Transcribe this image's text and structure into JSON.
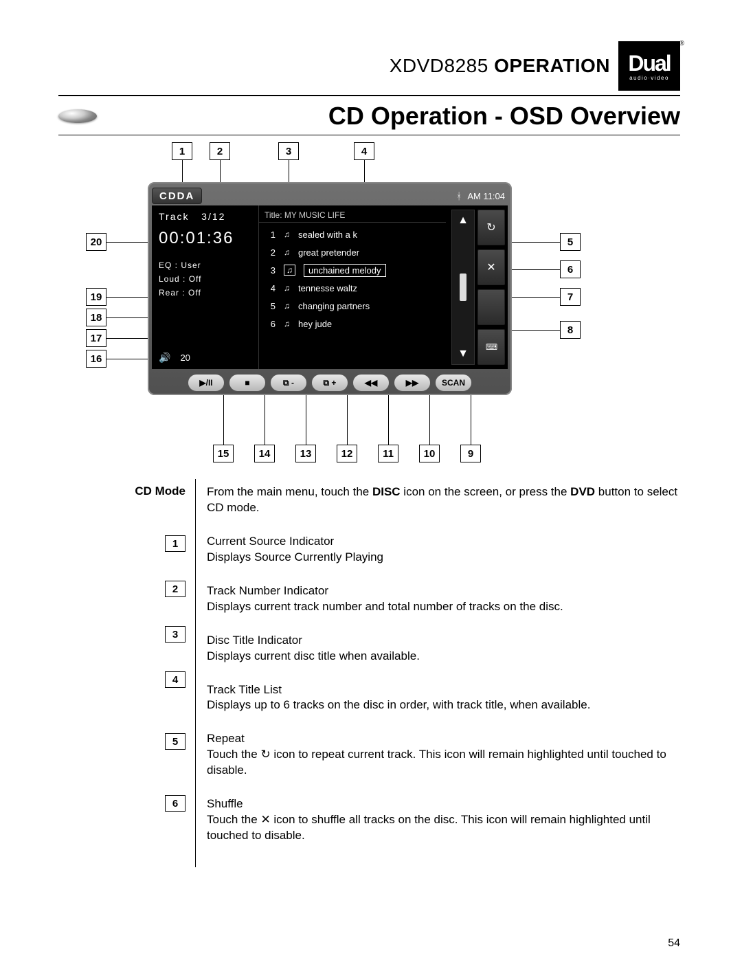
{
  "header": {
    "model": "XDVD8285",
    "word": "OPERATION",
    "logo_big": "Dual",
    "logo_sub": "audio·video"
  },
  "section_title": "CD Operation - OSD Overview",
  "callouts_top": [
    "1",
    "2",
    "3",
    "4"
  ],
  "callouts_right": [
    "5",
    "6",
    "7",
    "8"
  ],
  "callouts_left": [
    "20",
    "19",
    "18",
    "17",
    "16"
  ],
  "callouts_bottom": [
    "15",
    "14",
    "13",
    "12",
    "11",
    "10",
    "9"
  ],
  "device": {
    "source_badge": "CDDA",
    "clock": "AM 11:04",
    "track_label": "Track",
    "track_pos": "3/12",
    "timecode": "00:01:36",
    "eq": "EQ   : User",
    "loud": "Loud : Off",
    "rear": "Rear : Off",
    "volume": "20",
    "title_label": "Title: MY  MUSIC LIFE",
    "tracks": [
      {
        "n": "1",
        "name": "sealed with a k"
      },
      {
        "n": "2",
        "name": "great pretender"
      },
      {
        "n": "3",
        "name": "unchained melody",
        "selected": true
      },
      {
        "n": "4",
        "name": "tennesse waltz"
      },
      {
        "n": "5",
        "name": "changing partners"
      },
      {
        "n": "6",
        "name": "hey jude"
      }
    ],
    "side_buttons": {
      "repeat": "↻",
      "shuffle": "✕",
      "blank": "",
      "keyboard": "⌨"
    },
    "transport": {
      "playpause": "▶/II",
      "stop": "■",
      "folder_minus": "⧉ -",
      "folder_plus": "⧉ +",
      "rew": "◀◀",
      "ff": "▶▶",
      "scan": "SCAN"
    }
  },
  "desc": {
    "mode_label": "CD Mode",
    "mode_text_a": "From the main menu, touch the ",
    "mode_text_b": "DISC",
    "mode_text_c": " icon on the screen, or press the ",
    "mode_text_d": "DVD",
    "mode_text_e": " button to select CD mode.",
    "items": [
      {
        "n": "1",
        "title": "Current Source Indicator",
        "sub": "Displays Source Currently Playing"
      },
      {
        "n": "2",
        "title": "Track Number Indicator",
        "sub": "Displays current track number and total number of tracks on the disc."
      },
      {
        "n": "3",
        "title": "Disc Title Indicator",
        "sub": "Displays current disc title when available."
      },
      {
        "n": "4",
        "title": "Track Title List",
        "sub": "Displays up to 6 tracks on the disc in order, with track title, when available."
      },
      {
        "n": "5",
        "title": "Repeat",
        "sub": "Touch the ↻ icon to repeat current track. This icon will remain highlighted until touched to disable."
      },
      {
        "n": "6",
        "title": "Shuffle",
        "sub": "Touch the ✕ icon to shuffle all tracks on the disc. This icon will remain highlighted until touched to disable."
      }
    ]
  },
  "page_number": "54"
}
